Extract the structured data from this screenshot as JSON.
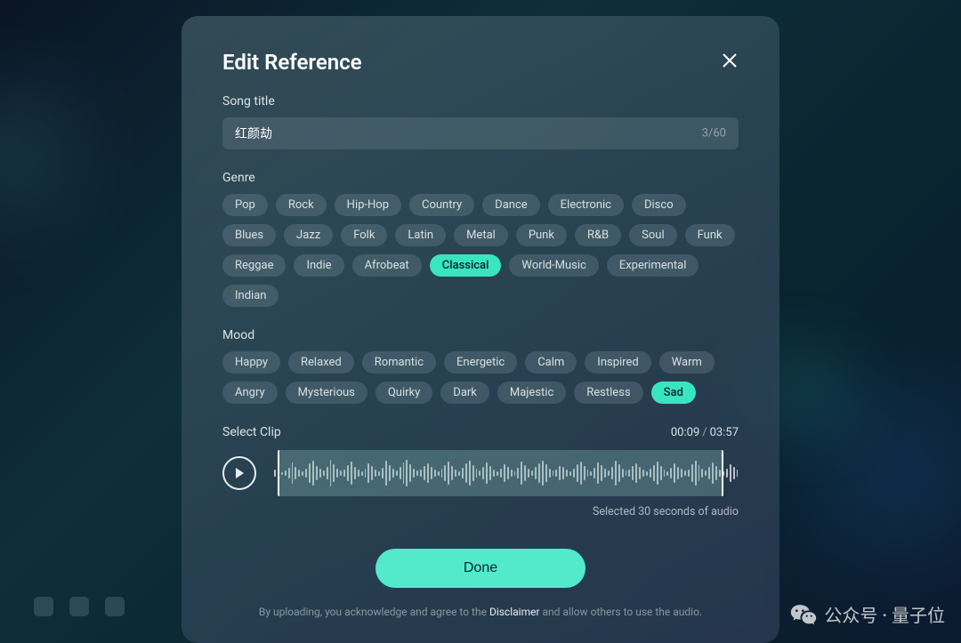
{
  "modal": {
    "title": "Edit Reference",
    "song_title_label": "Song title",
    "song_title_value": "红颜劫",
    "char_count": "3/60",
    "genre_label": "Genre",
    "genre_tags": [
      {
        "label": "Pop",
        "selected": false
      },
      {
        "label": "Rock",
        "selected": false
      },
      {
        "label": "Hip-Hop",
        "selected": false
      },
      {
        "label": "Country",
        "selected": false
      },
      {
        "label": "Dance",
        "selected": false
      },
      {
        "label": "Electronic",
        "selected": false
      },
      {
        "label": "Disco",
        "selected": false
      },
      {
        "label": "Blues",
        "selected": false
      },
      {
        "label": "Jazz",
        "selected": false
      },
      {
        "label": "Folk",
        "selected": false
      },
      {
        "label": "Latin",
        "selected": false
      },
      {
        "label": "Metal",
        "selected": false
      },
      {
        "label": "Punk",
        "selected": false
      },
      {
        "label": "R&B",
        "selected": false
      },
      {
        "label": "Soul",
        "selected": false
      },
      {
        "label": "Funk",
        "selected": false
      },
      {
        "label": "Reggae",
        "selected": false
      },
      {
        "label": "Indie",
        "selected": false
      },
      {
        "label": "Afrobeat",
        "selected": false
      },
      {
        "label": "Classical",
        "selected": true
      },
      {
        "label": "World-Music",
        "selected": false
      },
      {
        "label": "Experimental",
        "selected": false
      },
      {
        "label": "Indian",
        "selected": false
      }
    ],
    "mood_label": "Mood",
    "mood_tags": [
      {
        "label": "Happy",
        "selected": false
      },
      {
        "label": "Relaxed",
        "selected": false
      },
      {
        "label": "Romantic",
        "selected": false
      },
      {
        "label": "Energetic",
        "selected": false
      },
      {
        "label": "Calm",
        "selected": false
      },
      {
        "label": "Inspired",
        "selected": false
      },
      {
        "label": "Warm",
        "selected": false
      },
      {
        "label": "Angry",
        "selected": false
      },
      {
        "label": "Mysterious",
        "selected": false
      },
      {
        "label": "Quirky",
        "selected": false
      },
      {
        "label": "Dark",
        "selected": false
      },
      {
        "label": "Majestic",
        "selected": false
      },
      {
        "label": "Restless",
        "selected": false
      },
      {
        "label": "Sad",
        "selected": true
      }
    ],
    "clip_label": "Select Clip",
    "time_current": "00:09",
    "time_total": "03:57",
    "selected_text": "Selected 30 seconds of audio",
    "done_label": "Done",
    "disclaimer_pre": "By uploading, you acknowledge and agree to the ",
    "disclaimer_link": "Disclaimer",
    "disclaimer_post": " and allow others to use the audio."
  },
  "watermark": "公众号 · 量子位"
}
